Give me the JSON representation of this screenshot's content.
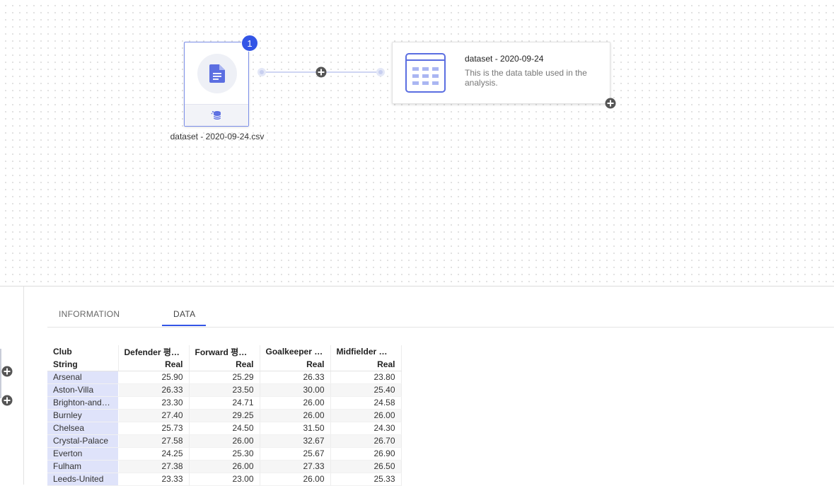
{
  "canvas": {
    "file_node": {
      "badge": "1",
      "label": "dataset - 2020-09-24.csv",
      "icon": "document-icon",
      "footer_icon": "database-icon"
    },
    "table_node": {
      "title": "dataset - 2020-09-24",
      "description": "This is the data table used in the analysis.",
      "icon": "table-icon"
    }
  },
  "tabs": {
    "information": "INFORMATION",
    "data": "DATA",
    "active": "DATA"
  },
  "table": {
    "columns": [
      {
        "name": "Club",
        "type": "String"
      },
      {
        "name": "Defender 평…",
        "type": "Real"
      },
      {
        "name": "Forward 평…",
        "type": "Real"
      },
      {
        "name": "Goalkeeper …",
        "type": "Real"
      },
      {
        "name": "Midfielder …",
        "type": "Real"
      }
    ],
    "rows": [
      [
        "Arsenal",
        "25.90",
        "25.29",
        "26.33",
        "23.80"
      ],
      [
        "Aston-Villa",
        "26.33",
        "23.50",
        "30.00",
        "25.40"
      ],
      [
        "Brighton-and…",
        "23.30",
        "24.71",
        "26.00",
        "24.58"
      ],
      [
        "Burnley",
        "27.40",
        "29.25",
        "26.00",
        "26.00"
      ],
      [
        "Chelsea",
        "25.73",
        "24.50",
        "31.50",
        "24.30"
      ],
      [
        "Crystal-Palace",
        "27.58",
        "26.00",
        "32.67",
        "26.70"
      ],
      [
        "Everton",
        "24.25",
        "25.30",
        "25.67",
        "26.90"
      ],
      [
        "Fulham",
        "27.38",
        "26.00",
        "27.33",
        "26.50"
      ],
      [
        "Leeds-United",
        "23.33",
        "23.00",
        "26.00",
        "25.33"
      ]
    ]
  },
  "colors": {
    "accent": "#3355e6",
    "club_cell_bg": "#dfe3fa",
    "node_border": "#7b8ee8"
  }
}
